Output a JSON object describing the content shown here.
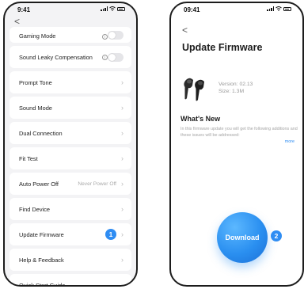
{
  "status_bar": {
    "time_left": "9:41",
    "time_right": "09:41"
  },
  "left_screen": {
    "back_glyph": "<",
    "rows": [
      {
        "label": "Gaming Mode",
        "control": "toggle",
        "info": true
      },
      {
        "label": "Sound Leaky Compensation",
        "control": "toggle",
        "info": true
      },
      {
        "label": "Prompt Tone",
        "control": "chevron"
      },
      {
        "label": "Sound Mode",
        "control": "chevron"
      },
      {
        "label": "Dual Connection",
        "control": "chevron"
      },
      {
        "label": "Fit Test",
        "control": "chevron"
      },
      {
        "label": "Auto Power Off",
        "value": "Never Power Off",
        "control": "chevron"
      },
      {
        "label": "Find Device",
        "control": "chevron"
      },
      {
        "label": "Update Firmware",
        "control": "chevron",
        "step_badge": "1"
      },
      {
        "label": "Help & Feedback",
        "control": "chevron"
      },
      {
        "label": "Quick Start Guide",
        "control": "chevron"
      }
    ]
  },
  "right_screen": {
    "back_glyph": "<",
    "title": "Update Firmware",
    "version": "Version: 02.13",
    "size": "Size: 1.3M",
    "whats_new": "What's New",
    "description": "In this firmware update you will get the following additions and these issues will be addressed:",
    "more": "more",
    "download_label": "Download",
    "step_badge": "2"
  },
  "icons": {
    "back": "chevron-left-icon",
    "chevron": "chevron-right-icon",
    "info": "info-icon"
  },
  "colors": {
    "accent": "#2f8df3",
    "list_bg": "#f3f3f5",
    "text_muted": "#a5a5a5"
  }
}
